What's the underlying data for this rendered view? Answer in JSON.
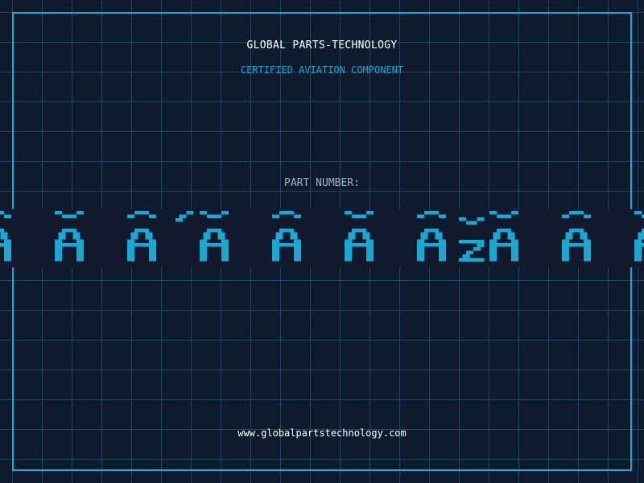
{
  "header": {
    "title": "GLOBAL PARTS-TECHNOLOGY",
    "subtitle": "CERTIFIED AVIATION COMPONENT"
  },
  "part": {
    "label": "PART NUMBER:",
    "value": "ÃĂÃ´ĂÃĂÃžĂÃĂ"
  },
  "footer": {
    "url": "www.globalpartstechnology.com"
  },
  "colors": {
    "background": "#0f1b2d",
    "grid": "#1c4760",
    "accent": "#1aa8d2",
    "band": "#111a2d",
    "text": "#ffffff",
    "muted": "#9fb2c4"
  }
}
